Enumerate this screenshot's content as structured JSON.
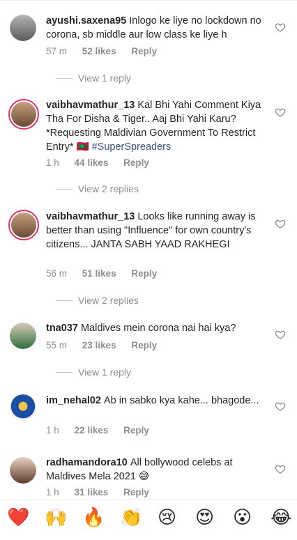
{
  "comments": [
    {
      "username": "ayushi.saxena95",
      "text": "Inlogo ke liye no lockdown no corona, sb middle aur low class ke liye h",
      "time": "57 m",
      "likes": "52 likes",
      "reply": "Reply",
      "view_replies": "View 1 reply"
    },
    {
      "username": "vaibhavmathur_13",
      "text": "Kal Bhi Yahi Comment Kiya Tha For Disha & Tiger.. Aaj Bhi Yahi Karu? *Requesting Maldivian Government To Restrict Entry* 🇲🇻",
      "hashtag": "#SuperSpreaders",
      "time": "1 h",
      "likes": "44 likes",
      "reply": "Reply",
      "view_replies": "View 2 replies"
    },
    {
      "username": "vaibhavmathur_13",
      "text": "Looks like running away is better than using \"Influence\" for own country's citizens... JANTA SABH YAAD RAKHEGI",
      "time": "56 m",
      "likes": "51 likes",
      "reply": "Reply",
      "view_replies": "View 2 replies"
    },
    {
      "username": "tna037",
      "text": "Maldives mein corona nai hai kya?",
      "time": "55 m",
      "likes": "23 likes",
      "reply": "Reply",
      "view_replies": "View 1 reply"
    },
    {
      "username": "im_nehal02",
      "text": "Ab in sabko kya kahe... bhagode...",
      "time": "1 h",
      "likes": "22 likes",
      "reply": "Reply"
    },
    {
      "username": "radhamandora10",
      "text": "All bollywood celebs at Maldives Mela 2021 😅",
      "time": "1 h",
      "likes": "31 likes",
      "reply": "Reply"
    }
  ],
  "emoji_bar": [
    "❤️",
    "🙌",
    "🔥",
    "👏",
    "😢",
    "😍",
    "😮",
    "😂"
  ],
  "colors": {
    "link": "#385185",
    "muted": "#8e8e8e",
    "story_ring": "#e1306c"
  }
}
